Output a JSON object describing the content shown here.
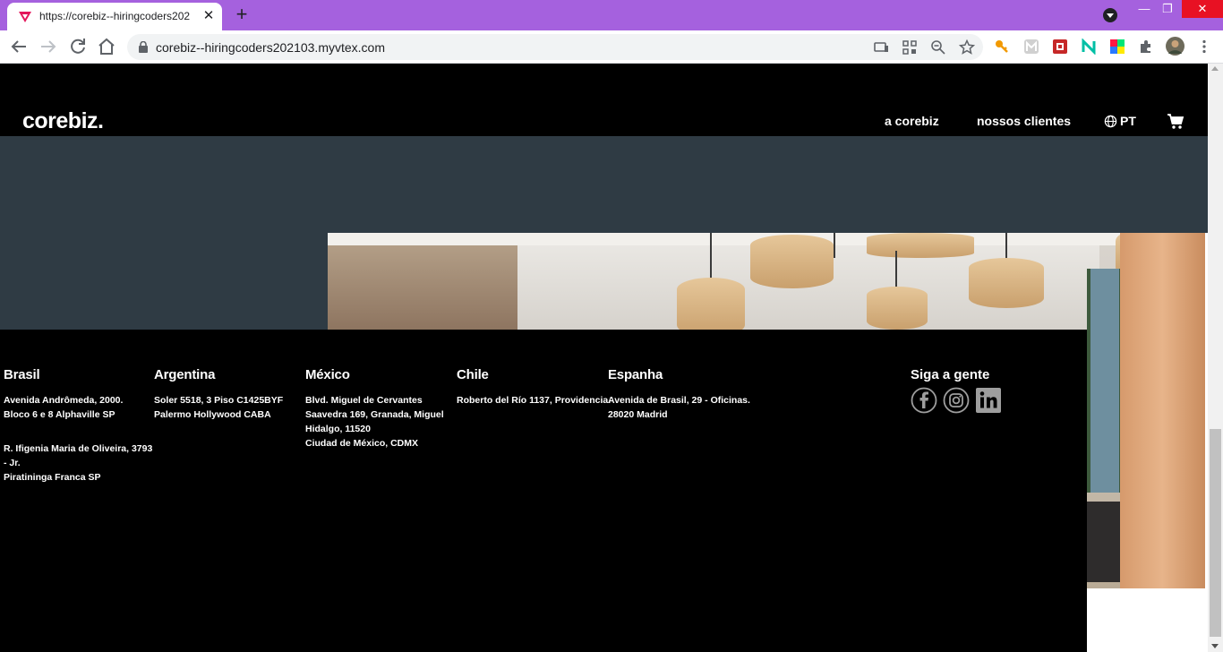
{
  "browser": {
    "tab_title": "https://corebiz--hiringcoders202",
    "tab_close": "✕",
    "new_tab": "+",
    "url": "corebiz--hiringcoders202103.myvtex.com",
    "window_minimize": "—",
    "window_restore": "❐",
    "window_close": "✕"
  },
  "header": {
    "logo": "corebiz.",
    "nav": [
      "a corebiz",
      "nossos clientes"
    ],
    "language": "PT"
  },
  "footer": {
    "columns": [
      {
        "country": "Brasil",
        "lines": [
          "Avenida Andrômeda, 2000.",
          "Bloco 6 e 8 Alphaville SP"
        ],
        "lines2": [
          "R. Ifigenia Maria de Oliveira, 3793",
          "- Jr.",
          "Piratininga Franca SP"
        ]
      },
      {
        "country": "Argentina",
        "lines": [
          "Soler 5518, 3 Piso C1425BYF",
          "Palermo Hollywood CABA"
        ]
      },
      {
        "country": "México",
        "lines": [
          "Blvd. Miguel de Cervantes",
          "Saavedra 169, Granada, Miguel",
          "Hidalgo, 11520",
          "Ciudad de México, CDMX"
        ]
      },
      {
        "country": "Chile",
        "lines": [
          "Roberto del Río 1137, Providencia."
        ]
      },
      {
        "country": "Espanha",
        "lines": [
          "Avenida de Brasil, 29 - Oficinas.",
          "28020 Madrid"
        ]
      }
    ],
    "social_heading": "Siga a gente"
  }
}
